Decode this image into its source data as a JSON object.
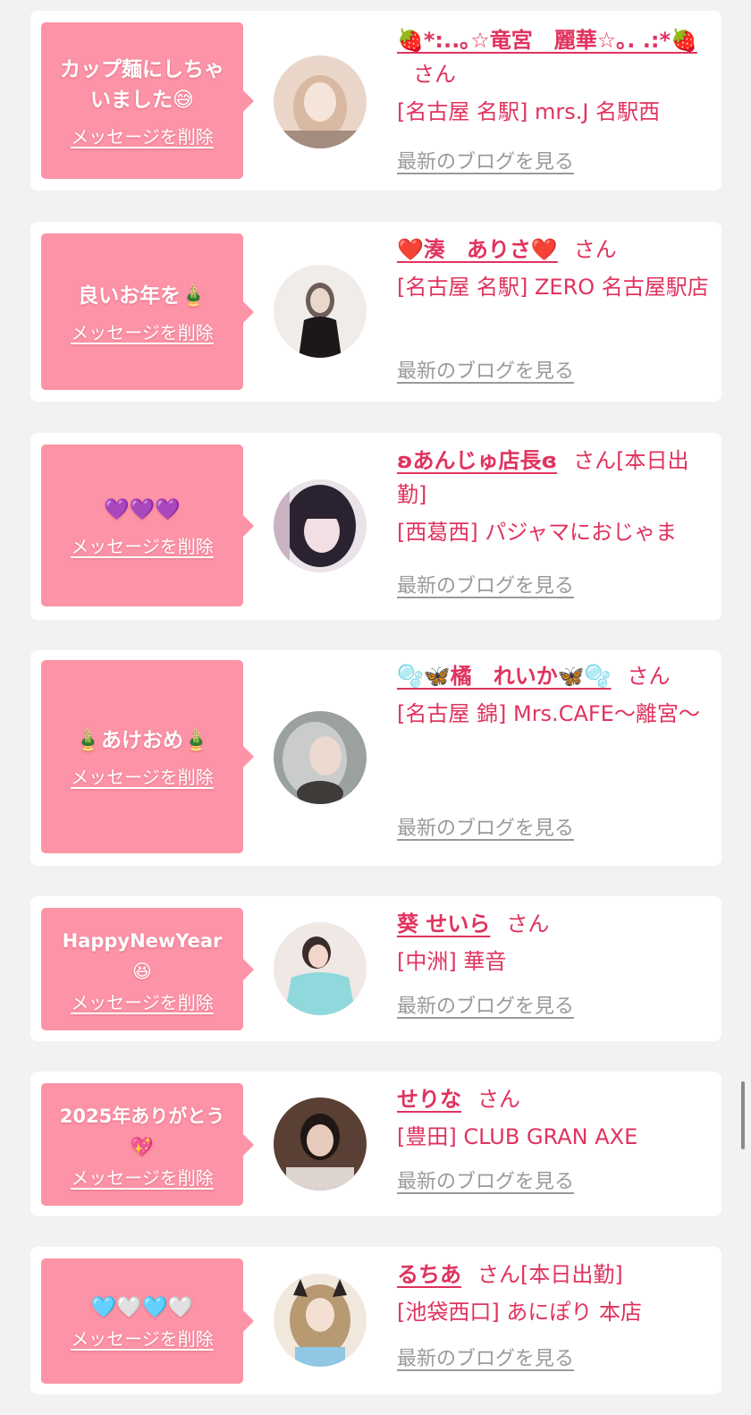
{
  "delete_label": "メッセージを削除",
  "blog_label": "最新のブログを見る",
  "san_label": "さん",
  "colors": {
    "bubble": "#fd93a6",
    "accent": "#e0335e",
    "blog_link": "#9a9a9a",
    "background": "#f2f2f2"
  },
  "cards": [
    {
      "message": "カップ麺にしちゃ\nいました😅",
      "name": "🍓*:..｡☆竜宮　麗華☆｡. .:*🍓",
      "san_extra": "",
      "shop": "[名古屋 名駅] mrs.J 名駅西",
      "avatar_colors": [
        "#e9d6c8",
        "#d9b9a2",
        "#a48d7e"
      ]
    },
    {
      "message": "良いお年を🎍",
      "name": "❤️湊　ありさ❤️",
      "san_extra": "",
      "shop": "[名古屋 名駅] ZERO 名古屋駅店",
      "avatar_colors": [
        "#f0ecea",
        "#6b5d56",
        "#1c1818"
      ]
    },
    {
      "message": "💜💜💜",
      "name": "ʚあんじゅ店長ɞ",
      "san_extra": "[本日出勤]",
      "shop": "[西葛西] パジャマにおじゃま",
      "avatar_colors": [
        "#eae3ea",
        "#2a2230",
        "#c9b3c2"
      ]
    },
    {
      "message": "🎍あけおめ🎍",
      "name": "🫧🦋橘　れいか🦋🫧",
      "san_extra": "",
      "shop": "[名古屋 錦] Mrs.CAFE〜離宮〜",
      "avatar_colors": [
        "#9aa19f",
        "#c9ccca",
        "#3e3b38"
      ]
    },
    {
      "message": "HappyNewYear\n😆",
      "name": "葵 せいら",
      "san_extra": "",
      "shop": "[中洲] 華音",
      "avatar_colors": [
        "#efe8e4",
        "#8fd8dc",
        "#3a2c2a"
      ]
    },
    {
      "message": "2025年ありがとう\n💖",
      "name": "せりな",
      "san_extra": "",
      "shop": "[豊田] CLUB GRAN AXE",
      "avatar_colors": [
        "#5a4034",
        "#e6cbbd",
        "#1f1713"
      ]
    },
    {
      "message": "🩵🤍🩵🤍",
      "name": "るちあ",
      "san_extra": "[本日出勤]",
      "shop": "[池袋西口] あにぽり 本店",
      "avatar_colors": [
        "#f0e8dc",
        "#b89a72",
        "#8fc7e4"
      ]
    }
  ]
}
